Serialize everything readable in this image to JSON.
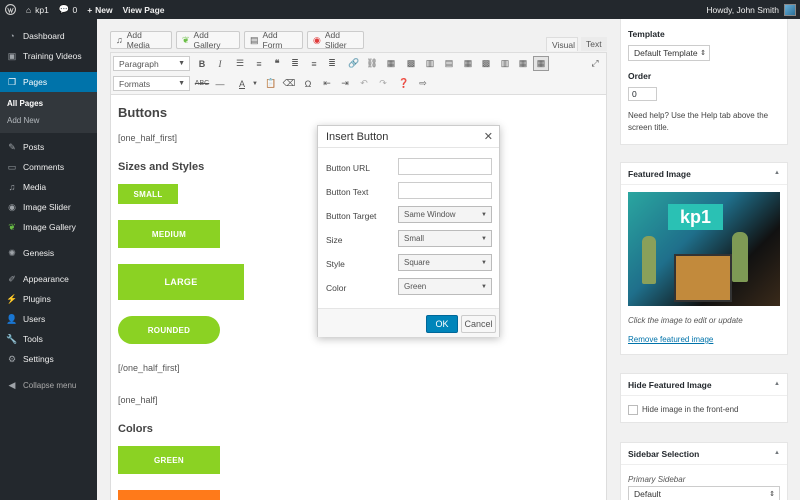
{
  "adminbar": {
    "site_name": "kp1",
    "comments_count": "0",
    "new_label": "New",
    "view_page_label": "View Page",
    "greeting": "Howdy, John Smith"
  },
  "sidebar": {
    "items": [
      {
        "label": "Dashboard",
        "icon": "dashboard-icon"
      },
      {
        "label": "Training Videos",
        "icon": "video-icon"
      },
      {
        "label": "Pages",
        "icon": "pages-icon"
      },
      {
        "label": "Posts",
        "icon": "pin-icon"
      },
      {
        "label": "Comments",
        "icon": "comment-icon"
      },
      {
        "label": "Media",
        "icon": "media-icon"
      },
      {
        "label": "Image Slider",
        "icon": "slider-icon"
      },
      {
        "label": "Image Gallery",
        "icon": "leaf-icon"
      },
      {
        "label": "Genesis",
        "icon": "genesis-icon"
      },
      {
        "label": "Appearance",
        "icon": "brush-icon"
      },
      {
        "label": "Plugins",
        "icon": "plug-icon"
      },
      {
        "label": "Users",
        "icon": "user-icon"
      },
      {
        "label": "Tools",
        "icon": "wrench-icon"
      },
      {
        "label": "Settings",
        "icon": "settings-icon"
      }
    ],
    "submenu": [
      "All Pages",
      "Add New"
    ],
    "collapse_label": "Collapse menu"
  },
  "editor": {
    "media_buttons": [
      "Add Media",
      "Add Gallery",
      "Add Form",
      "Add Slider"
    ],
    "tabs": {
      "visual": "Visual",
      "text": "Text"
    },
    "format_select": "Paragraph",
    "formats_select": "Formats"
  },
  "content": {
    "h_buttons": "Buttons",
    "shortcode1": "[one_half_first]",
    "h_sizes": "Sizes and Styles",
    "btn_small": "SMALL",
    "btn_medium": "MEDIUM",
    "btn_large": "LARGE",
    "btn_rounded": "ROUNDED",
    "shortcode2": "[/one_half_first]",
    "shortcode3": "[one_half]",
    "h_colors": "Colors",
    "btn_green": "GREEN",
    "green_color": "#8bd223",
    "orange_color": "#ff7a1a"
  },
  "dialog": {
    "title": "Insert Button",
    "fields": {
      "url_label": "Button URL",
      "text_label": "Button Text",
      "target_label": "Button Target",
      "target_value": "Same Window",
      "size_label": "Size",
      "size_value": "Small",
      "style_label": "Style",
      "style_value": "Square",
      "color_label": "Color",
      "color_value": "Green"
    },
    "ok": "OK",
    "cancel": "Cancel"
  },
  "right": {
    "template_label": "Template",
    "template_value": "Default Template",
    "order_label": "Order",
    "order_value": "0",
    "help_text": "Need help? Use the Help tab above the screen title.",
    "featured_title": "Featured Image",
    "featured_caption": "Click the image to edit or update",
    "featured_remove": "Remove featured image",
    "featured_image_text": "kp1",
    "hide_title": "Hide Featured Image",
    "hide_checkbox_label": "Hide image in the front-end",
    "sidebar_title": "Sidebar Selection",
    "primary_sidebar_label": "Primary Sidebar",
    "primary_sidebar_value": "Default"
  }
}
